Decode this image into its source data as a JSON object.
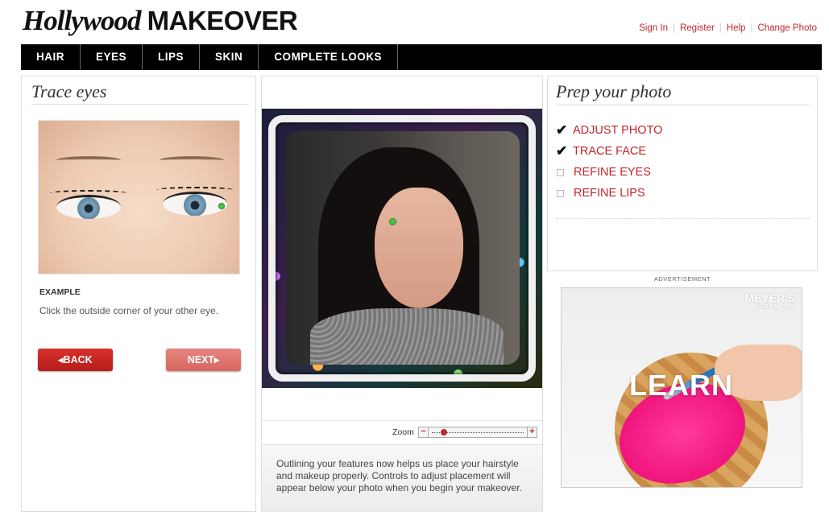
{
  "header": {
    "logo_script": "Hollywood",
    "logo_bold": "MAKEOVER",
    "links": [
      "Sign In",
      "Register",
      "Help",
      "Change Photo"
    ]
  },
  "nav": {
    "items": [
      "HAIR",
      "EYES",
      "LIPS",
      "SKIN",
      "COMPLETE LOOKS"
    ]
  },
  "left_panel": {
    "title": "Trace eyes",
    "example_label": "EXAMPLE",
    "instruction": "Click the outside corner of your other eye.",
    "back_label": "◂BACK",
    "next_label": "NEXT▸"
  },
  "center_panel": {
    "zoom_label": "Zoom",
    "zoom_minus": "−",
    "zoom_plus": "+",
    "zoom_level": 0.1,
    "info_text": "Outlining your features now helps us place your hairstyle and makeup properly. Controls to adjust placement will appear below your photo when you begin your makeover."
  },
  "right_panel": {
    "title": "Prep your photo",
    "steps": [
      {
        "label": "ADJUST PHOTO",
        "done": true
      },
      {
        "label": "TRACE FACE",
        "done": true
      },
      {
        "label": "REFINE EYES",
        "done": false
      },
      {
        "label": "REFINE LIPS",
        "done": false
      }
    ]
  },
  "advertisement": {
    "label": "ADVERTISEMENT",
    "brand": "MEYER'S",
    "brand_sub": "CLEAN DAY",
    "headline": "LEARN"
  },
  "colors": {
    "accent": "#c1272d",
    "nav_bg": "#000000",
    "progress_dot": "#48c248"
  }
}
